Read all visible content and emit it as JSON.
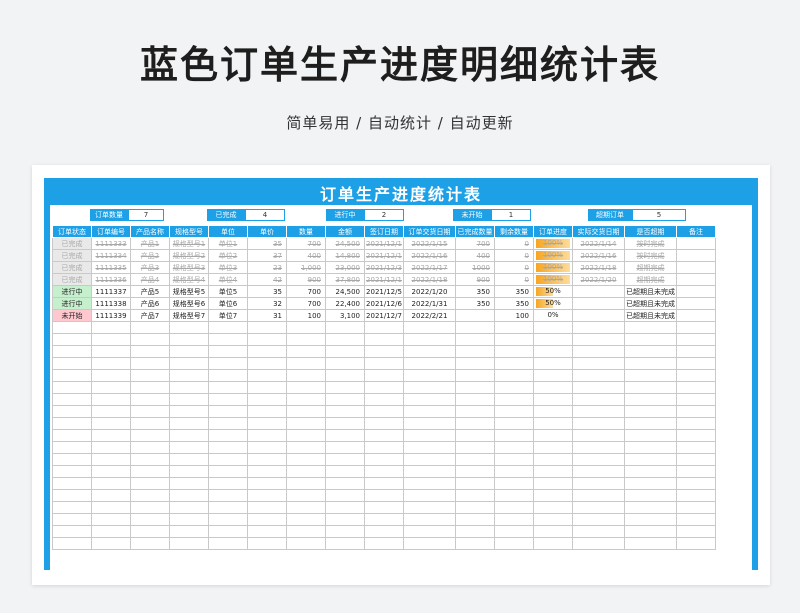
{
  "page": {
    "title": "蓝色订单生产进度明细统计表",
    "subtitle": "简单易用 / 自动统计 / 自动更新"
  },
  "sheet": {
    "title": "订单生产进度统计表",
    "summary": [
      {
        "label": "订单数量",
        "value": "7"
      },
      {
        "label": "已完成",
        "value": "4"
      },
      {
        "label": "进行中",
        "value": "2"
      },
      {
        "label": "未开始",
        "value": "1"
      },
      {
        "label": "超期订单",
        "value": "5"
      }
    ],
    "headers": [
      "订单状态",
      "订单编号",
      "产品名称",
      "规格型号",
      "单位",
      "单价",
      "数量",
      "金额",
      "签订日期",
      "订单交货日期",
      "已完成数量",
      "剩余数量",
      "订单进度",
      "实际交货日期",
      "是否超期",
      "备注"
    ],
    "rows": [
      {
        "status": "已完成",
        "status_type": "done",
        "order_no": "1111333",
        "product": "产品1",
        "spec": "规格型号1",
        "unit": "单位1",
        "price": "35",
        "qty": "700",
        "amount": "24,500",
        "sign_date": "2021/12/1",
        "due_date": "2022/1/15",
        "done_qty": "700",
        "remain": "0",
        "progress": "100%",
        "progress_value": 100,
        "actual_date": "2022/1/14",
        "overdue": "按时完成",
        "note": ""
      },
      {
        "status": "已完成",
        "status_type": "done",
        "order_no": "1111334",
        "product": "产品2",
        "spec": "规格型号2",
        "unit": "单位2",
        "price": "37",
        "qty": "400",
        "amount": "14,800",
        "sign_date": "2021/12/1",
        "due_date": "2022/1/16",
        "done_qty": "400",
        "remain": "0",
        "progress": "100%",
        "progress_value": 100,
        "actual_date": "2022/1/16",
        "overdue": "按时完成",
        "note": ""
      },
      {
        "status": "已完成",
        "status_type": "done",
        "order_no": "1111335",
        "product": "产品3",
        "spec": "规格型号3",
        "unit": "单位3",
        "price": "23",
        "qty": "1,000",
        "amount": "23,000",
        "sign_date": "2021/12/3",
        "due_date": "2022/1/17",
        "done_qty": "1000",
        "remain": "0",
        "progress": "100%",
        "progress_value": 100,
        "actual_date": "2022/1/18",
        "overdue": "超期完成",
        "note": ""
      },
      {
        "status": "已完成",
        "status_type": "done",
        "order_no": "1111336",
        "product": "产品4",
        "spec": "规格型号4",
        "unit": "单位4",
        "price": "42",
        "qty": "900",
        "amount": "37,800",
        "sign_date": "2021/12/1",
        "due_date": "2022/1/18",
        "done_qty": "900",
        "remain": "0",
        "progress": "100%",
        "progress_value": 100,
        "actual_date": "2022/1/20",
        "overdue": "超期完成",
        "note": ""
      },
      {
        "status": "进行中",
        "status_type": "prog",
        "order_no": "1111337",
        "product": "产品5",
        "spec": "规格型号5",
        "unit": "单位5",
        "price": "35",
        "qty": "700",
        "amount": "24,500",
        "sign_date": "2021/12/5",
        "due_date": "2022/1/20",
        "done_qty": "350",
        "remain": "350",
        "progress": "50%",
        "progress_value": 50,
        "actual_date": "",
        "overdue": "已超期且未完成",
        "note": ""
      },
      {
        "status": "进行中",
        "status_type": "prog",
        "order_no": "1111338",
        "product": "产品6",
        "spec": "规格型号6",
        "unit": "单位6",
        "price": "32",
        "qty": "700",
        "amount": "22,400",
        "sign_date": "2021/12/6",
        "due_date": "2022/1/31",
        "done_qty": "350",
        "remain": "350",
        "progress": "50%",
        "progress_value": 50,
        "actual_date": "",
        "overdue": "已超期且未完成",
        "note": ""
      },
      {
        "status": "未开始",
        "status_type": "none",
        "order_no": "1111339",
        "product": "产品7",
        "spec": "规格型号7",
        "unit": "单位7",
        "price": "31",
        "qty": "100",
        "amount": "3,100",
        "sign_date": "2021/12/7",
        "due_date": "2022/2/21",
        "done_qty": "",
        "remain": "100",
        "progress": "0%",
        "progress_value": 0,
        "actual_date": "",
        "overdue": "已超期且未完成",
        "note": ""
      }
    ]
  }
}
